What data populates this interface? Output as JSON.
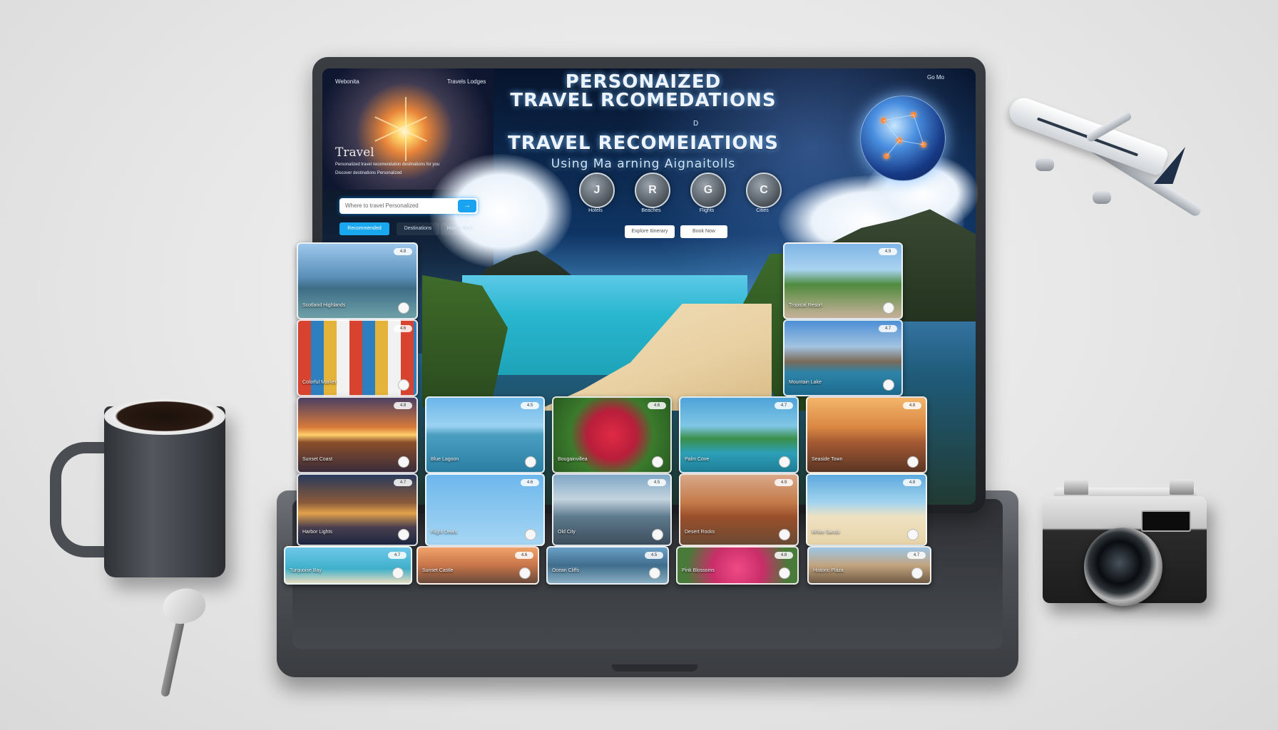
{
  "colors": {
    "accent": "#19a7ef",
    "title_glow": "#78beff",
    "laptop": "#2b2d31"
  },
  "header": {
    "title_line1": "PERSONAIZED",
    "title_line2": "TRAVEL RCOMEDATIONS",
    "small_glyph": "D",
    "title_line3": "TRAVEL RECOMEIATIONS",
    "subtitle": "Using Ma  arning Aignaitolls",
    "brand_text": "Webonita",
    "top_links": "Travels  Lodges",
    "top_right": "Go  Mo"
  },
  "left_panel": {
    "travel_label": "Travel",
    "desc_line1": "Personalized travel recomendation destinations for you",
    "desc_line2": "Discover  destinations  Personalized",
    "search": {
      "placeholder": "Where to  travel   Personalized",
      "button_icon": "search-icon"
    },
    "filter_pills": [
      "Recommended",
      "Destinations",
      "Hotels Bars"
    ]
  },
  "center_buttons": [
    "Explore Itinerary",
    "Book Now"
  ],
  "icon_circles": [
    {
      "glyph": "J",
      "label": "Hotels",
      "icon": "hotel-icon"
    },
    {
      "glyph": "R",
      "label": "Beaches",
      "icon": "beach-icon"
    },
    {
      "glyph": "G",
      "label": "Flights",
      "icon": "flight-icon"
    },
    {
      "glyph": "C",
      "label": "Cities",
      "icon": "city-icon"
    }
  ],
  "cards": [
    {
      "label": "Scotland Highlands",
      "badge": "4.8"
    },
    {
      "label": "Colorful Market",
      "badge": "4.6"
    },
    {
      "label": "Tropical Resort",
      "badge": "4.9"
    },
    {
      "label": "Mountain Lake",
      "badge": "4.7"
    },
    {
      "label": "Sunset Coast",
      "badge": "4.8"
    },
    {
      "label": "Blue Lagoon",
      "badge": "4.5"
    },
    {
      "label": "Bougainvillea",
      "badge": "4.6"
    },
    {
      "label": "Palm Cove",
      "badge": "4.7"
    },
    {
      "label": "Seaside Town",
      "badge": "4.8"
    },
    {
      "label": "Harbor Lights",
      "badge": "4.7"
    },
    {
      "label": "Flight Deals",
      "badge": "4.6"
    },
    {
      "label": "Old City",
      "badge": "4.5"
    },
    {
      "label": "Desert Rocks",
      "badge": "4.9"
    },
    {
      "label": "White Sands",
      "badge": "4.8"
    },
    {
      "label": "Turquoise Bay",
      "badge": "4.7"
    },
    {
      "label": "Sunset Castle",
      "badge": "4.6"
    },
    {
      "label": "Ocean Cliffs",
      "badge": "4.5"
    },
    {
      "label": "Pink Blossoms",
      "badge": "4.8"
    },
    {
      "label": "Historic Plaza",
      "badge": "4.7"
    }
  ],
  "props": {
    "mug": "coffee-mug",
    "spoon": "spoon",
    "camera": "camera",
    "plane": "airplane"
  }
}
